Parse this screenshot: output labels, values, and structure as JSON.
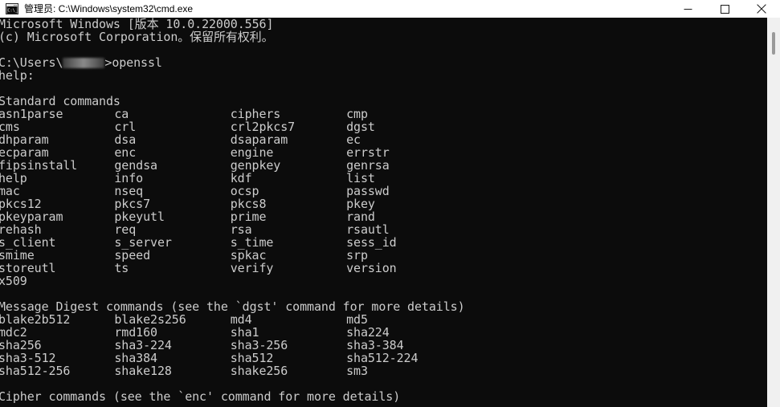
{
  "window": {
    "title": "管理员: C:\\Windows\\system32\\cmd.exe",
    "icon": "cmd-console-icon",
    "background_color": "#0c0c0c",
    "text_color": "#cccccc",
    "titlebar_color": "#ffffff"
  },
  "controls": {
    "minimize_label": "—",
    "maximize_label": "□",
    "close_label": "✕",
    "minimize_name": "minimize",
    "maximize_name": "maximize",
    "close_name": "close"
  },
  "scrollbar": {
    "thumb_position_percent": 4
  },
  "console": {
    "banner": [
      "Microsoft Windows [版本 10.0.22000.556]",
      "(c) Microsoft Corporation。保留所有权利。"
    ],
    "prompt": {
      "prefix": "C:\\Users\\",
      "username_redacted": true,
      "suffix": ">",
      "command": "openssl"
    },
    "help_label": "help:",
    "sections": [
      {
        "title": "Standard commands",
        "rows": [
          [
            "asn1parse",
            "ca",
            "ciphers",
            "cmp"
          ],
          [
            "cms",
            "crl",
            "crl2pkcs7",
            "dgst"
          ],
          [
            "dhparam",
            "dsa",
            "dsaparam",
            "ec"
          ],
          [
            "ecparam",
            "enc",
            "engine",
            "errstr"
          ],
          [
            "fipsinstall",
            "gendsa",
            "genpkey",
            "genrsa"
          ],
          [
            "help",
            "info",
            "kdf",
            "list"
          ],
          [
            "mac",
            "nseq",
            "ocsp",
            "passwd"
          ],
          [
            "pkcs12",
            "pkcs7",
            "pkcs8",
            "pkey"
          ],
          [
            "pkeyparam",
            "pkeyutl",
            "prime",
            "rand"
          ],
          [
            "rehash",
            "req",
            "rsa",
            "rsautl"
          ],
          [
            "s_client",
            "s_server",
            "s_time",
            "sess_id"
          ],
          [
            "smime",
            "speed",
            "spkac",
            "srp"
          ],
          [
            "storeutl",
            "ts",
            "verify",
            "version"
          ],
          [
            "x509",
            "",
            "",
            ""
          ]
        ]
      },
      {
        "title": "Message Digest commands (see the `dgst' command for more details)",
        "rows": [
          [
            "blake2b512",
            "blake2s256",
            "md4",
            "md5"
          ],
          [
            "mdc2",
            "rmd160",
            "sha1",
            "sha224"
          ],
          [
            "sha256",
            "sha3-224",
            "sha3-256",
            "sha3-384"
          ],
          [
            "sha3-512",
            "sha384",
            "sha512",
            "sha512-224"
          ],
          [
            "sha512-256",
            "shake128",
            "shake256",
            "sm3"
          ]
        ]
      },
      {
        "title": "Cipher commands (see the `enc' command for more details)",
        "rows": []
      }
    ]
  }
}
